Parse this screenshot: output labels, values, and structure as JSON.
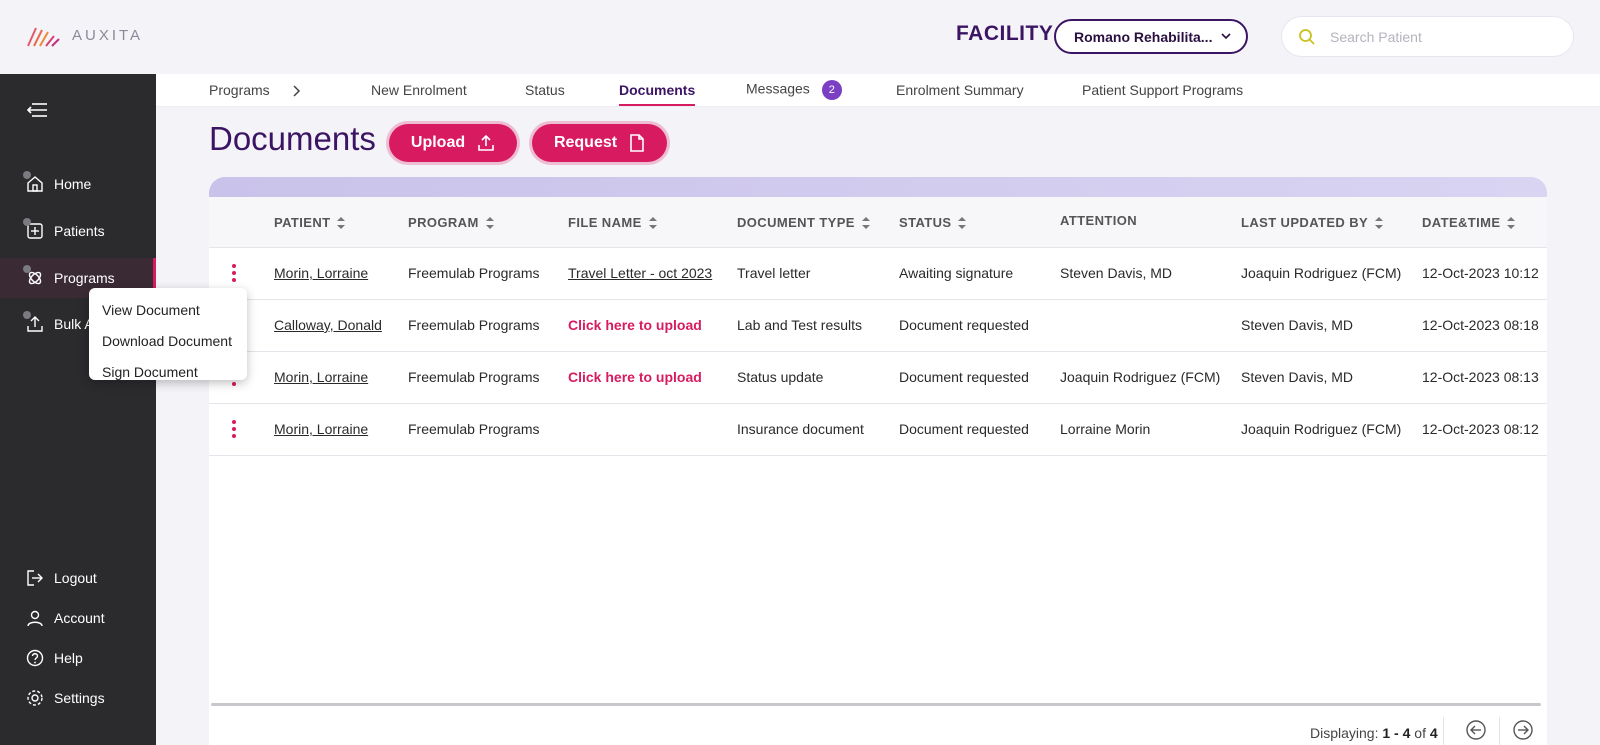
{
  "brand": {
    "name": "AUXITA"
  },
  "header": {
    "facility_label": "FACILITY",
    "facility_value": "Romano Rehabilita...",
    "search_placeholder": "Search Patient"
  },
  "sidebar": {
    "items": [
      {
        "label": "Home",
        "icon": "home-icon"
      },
      {
        "label": "Patients",
        "icon": "patients-icon"
      },
      {
        "label": "Programs",
        "icon": "programs-icon",
        "active": true
      },
      {
        "label": "Bulk A",
        "icon": "upload-icon"
      },
      {
        "label": "Logout",
        "icon": "logout-icon"
      },
      {
        "label": "Account",
        "icon": "account-icon"
      },
      {
        "label": "Help",
        "icon": "help-icon"
      },
      {
        "label": "Settings",
        "icon": "settings-icon"
      }
    ]
  },
  "tabs": [
    {
      "label": "Programs"
    },
    {
      "label": "New Enrolment"
    },
    {
      "label": "Status"
    },
    {
      "label": "Documents",
      "active": true
    },
    {
      "label": "Messages",
      "badge": "2"
    },
    {
      "label": "Enrolment Summary"
    },
    {
      "label": "Patient Support Programs"
    }
  ],
  "page": {
    "title": "Documents",
    "upload_label": "Upload",
    "request_label": "Request"
  },
  "table": {
    "columns": [
      "PATIENT",
      "PROGRAM",
      "FILE NAME",
      "DOCUMENT TYPE",
      "STATUS",
      "ATTENTION",
      "LAST UPDATED BY",
      "DATE&TIME"
    ],
    "rows": [
      {
        "patient": "Morin, Lorraine",
        "program": "Freemulab Programs",
        "file_name": "Travel Letter - oct 2023",
        "doc_type": "Travel letter",
        "status": "Awaiting signature",
        "attention": "Steven Davis, MD",
        "updated_by": "Joaquin Rodriguez (FCM)",
        "datetime": "12-Oct-2023 10:12"
      },
      {
        "patient": "Calloway, Donald",
        "program": "Freemulab Programs",
        "file_name": "Click here to upload",
        "doc_type": "Lab and Test results",
        "status": "Document requested",
        "attention": "",
        "updated_by": "Steven Davis, MD",
        "datetime": "12-Oct-2023 08:18"
      },
      {
        "patient": "Morin, Lorraine",
        "program": "Freemulab Programs",
        "file_name": "Click here to upload",
        "doc_type": "Status update",
        "status": "Document requested",
        "attention": "Joaquin Rodriguez (FCM)",
        "updated_by": "Steven Davis, MD",
        "datetime": "12-Oct-2023 08:13"
      },
      {
        "patient": "Morin, Lorraine",
        "program": "Freemulab Programs",
        "file_name": "",
        "doc_type": "Insurance document",
        "status": "Document requested",
        "attention": "Lorraine Morin",
        "updated_by": "Joaquin Rodriguez (FCM)",
        "datetime": "12-Oct-2023 08:12"
      }
    ]
  },
  "pagination": {
    "prefix": "Displaying:",
    "range": "1 - 4",
    "of": "of",
    "total": "4"
  },
  "context_menu": {
    "items": [
      "View Document",
      "Download Document",
      "Sign Document"
    ]
  },
  "colors": {
    "primary": "#3b1463",
    "accent": "#d81b60",
    "sidebar": "#2b2a2d"
  }
}
